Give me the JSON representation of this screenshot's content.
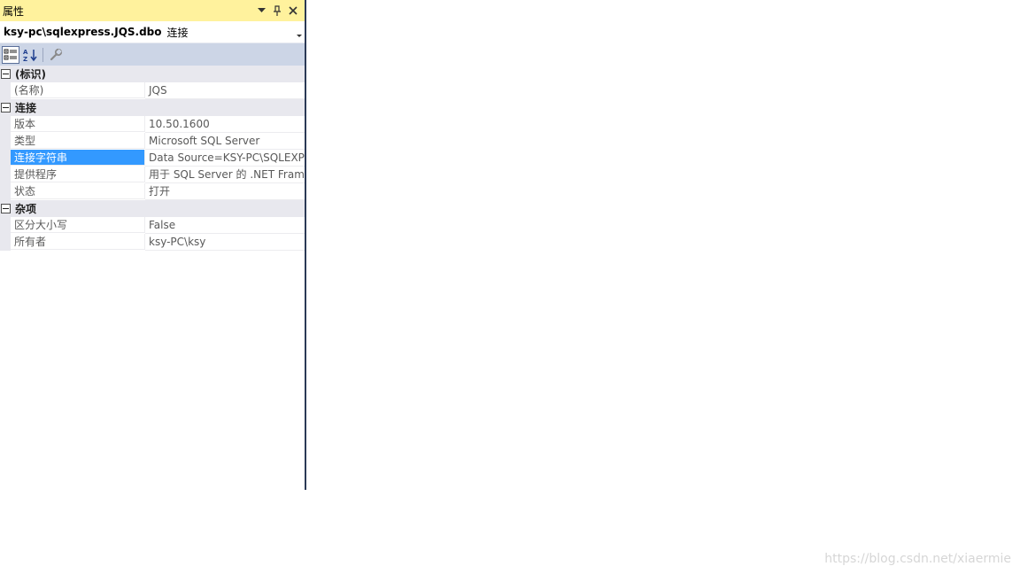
{
  "panel": {
    "title": "属性",
    "title_icons": [
      "dropdown-icon",
      "pin-icon",
      "close-icon"
    ],
    "object_name": "ksy-pc\\sqlexpress.JQS.dbo",
    "object_type": "连接",
    "toolbar": [
      "categorized-icon",
      "alphabetical-sort-icon",
      "property-pages-icon"
    ]
  },
  "categories": [
    {
      "label": "(标识)",
      "rows": [
        {
          "name": "(名称)",
          "value": "JQS"
        }
      ]
    },
    {
      "label": "连接",
      "rows": [
        {
          "name": "版本",
          "value": "10.50.1600"
        },
        {
          "name": "类型",
          "value": "Microsoft SQL Server"
        },
        {
          "name": "连接字符串",
          "value": "Data Source=KSY-PC\\SQLEXPRESS"
        },
        {
          "name": "提供程序",
          "value": "用于 SQL Server 的 .NET Framework"
        },
        {
          "name": "状态",
          "value": "打开"
        }
      ]
    },
    {
      "label": "杂项",
      "rows": [
        {
          "name": "区分大小写",
          "value": "False"
        },
        {
          "name": "所有者",
          "value": "ksy-PC\\ksy"
        }
      ]
    }
  ],
  "selected_row": "连接字符串",
  "watermark": "https://blog.csdn.net/xiaermie",
  "colors": {
    "title_bar": "#fff29d",
    "toolbar": "#ccd5e6",
    "selection": "#3399ff",
    "category_bg": "#e8e8ee"
  }
}
